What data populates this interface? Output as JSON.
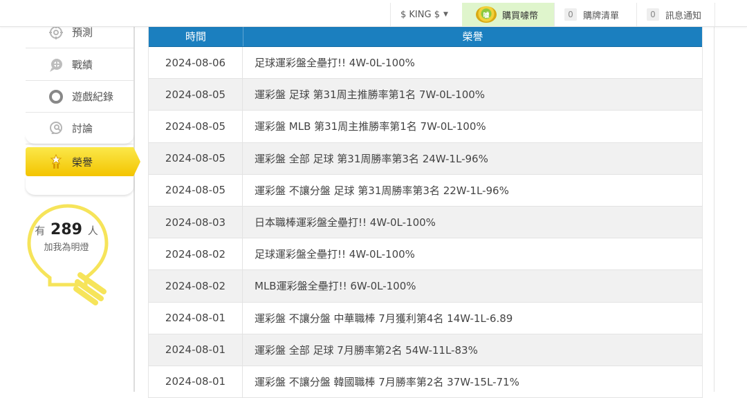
{
  "topbar": {
    "user_label": "$ KING $",
    "buy_label": "購買噱幣",
    "buy_icon_text": "噱",
    "cart_count": "0",
    "cart_label": "購牌清單",
    "notice_count": "0",
    "notice_label": "訊息通知"
  },
  "sidebar": {
    "items": [
      {
        "label": "預測",
        "icon": "target-icon"
      },
      {
        "label": "戰績",
        "icon": "chat-icon"
      },
      {
        "label": "遊戲紀錄",
        "icon": "circle-icon"
      },
      {
        "label": "討論",
        "icon": "discussion-icon"
      },
      {
        "label": "榮譽",
        "icon": "medal-icon"
      }
    ],
    "bulb": {
      "prefix": "有",
      "count": "289",
      "suffix": "人",
      "line2": "加我為明燈"
    }
  },
  "table": {
    "headers": {
      "date": "時間",
      "honor": "榮譽"
    },
    "rows": [
      {
        "date": "2024-08-06",
        "honor": "足球運彩盤全壘打!! 4W-0L-100%"
      },
      {
        "date": "2024-08-05",
        "honor": "運彩盤 足球 第31周主推勝率第1名 7W-0L-100%"
      },
      {
        "date": "2024-08-05",
        "honor": "運彩盤 MLB 第31周主推勝率第1名 7W-0L-100%"
      },
      {
        "date": "2024-08-05",
        "honor": "運彩盤 全部 足球 第31周勝率第3名 24W-1L-96%"
      },
      {
        "date": "2024-08-05",
        "honor": "運彩盤 不讓分盤 足球 第31周勝率第3名 22W-1L-96%"
      },
      {
        "date": "2024-08-03",
        "honor": "日本職棒運彩盤全壘打!! 4W-0L-100%"
      },
      {
        "date": "2024-08-02",
        "honor": "足球運彩盤全壘打!! 4W-0L-100%"
      },
      {
        "date": "2024-08-02",
        "honor": "MLB運彩盤全壘打!! 6W-0L-100%"
      },
      {
        "date": "2024-08-01",
        "honor": "運彩盤 不讓分盤 中華職棒 7月獲利第4名 14W-1L-6.89"
      },
      {
        "date": "2024-08-01",
        "honor": "運彩盤 全部 足球 7月勝率第2名 54W-11L-83%"
      },
      {
        "date": "2024-08-01",
        "honor": "運彩盤 不讓分盤 韓國職棒 7月勝率第2名 37W-15L-71%"
      }
    ]
  },
  "colors": {
    "header_blue": "#1b7fbf",
    "active_tab": "#f5cd12",
    "buy_bg": "#dff5cc",
    "bulb": "#f6e45a"
  }
}
